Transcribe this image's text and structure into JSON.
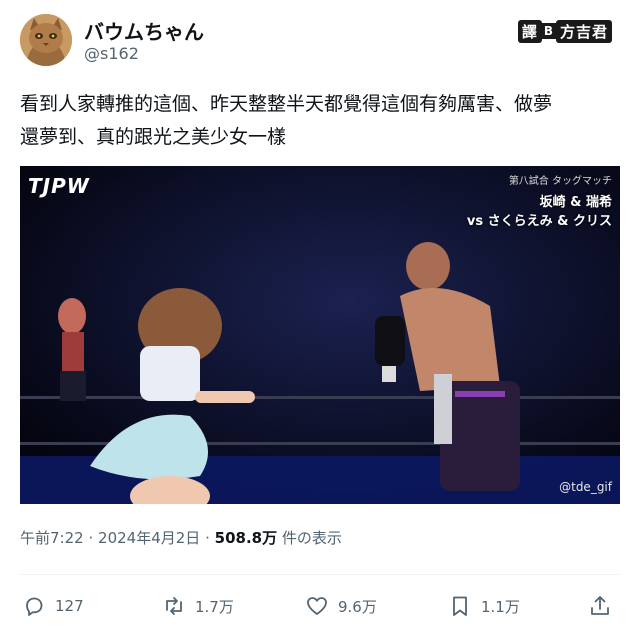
{
  "user": {
    "display_name": "バウムちゃん",
    "handle": "@s162"
  },
  "watermark": {
    "left": "譯",
    "sep": "B",
    "right": "方吉君"
  },
  "tweet": {
    "line1": "看到人家轉推的這個、昨天整整半天都覺得這個有夠厲害、做夢",
    "line2": "還夢到、真的跟光之美少女一樣"
  },
  "media": {
    "logo": "TJPW",
    "match_label": "第八試合 タッグマッチ",
    "team1": "坂崎 & 瑞希",
    "team2": "vs さくらえみ & クリス",
    "credit": "@tde_gif"
  },
  "meta": {
    "time": "午前7:22",
    "sep1": "·",
    "date": "2024年4月2日",
    "sep2": "·",
    "views": "508.8万",
    "views_label": "件の表示"
  },
  "actions": {
    "replies": "127",
    "reposts": "1.7万",
    "likes": "9.6万",
    "bookmarks": "1.1万"
  },
  "icons": {
    "reply": "reply-icon",
    "repost": "repost-icon",
    "like": "heart-icon",
    "bookmark": "bookmark-icon",
    "share": "share-icon"
  }
}
